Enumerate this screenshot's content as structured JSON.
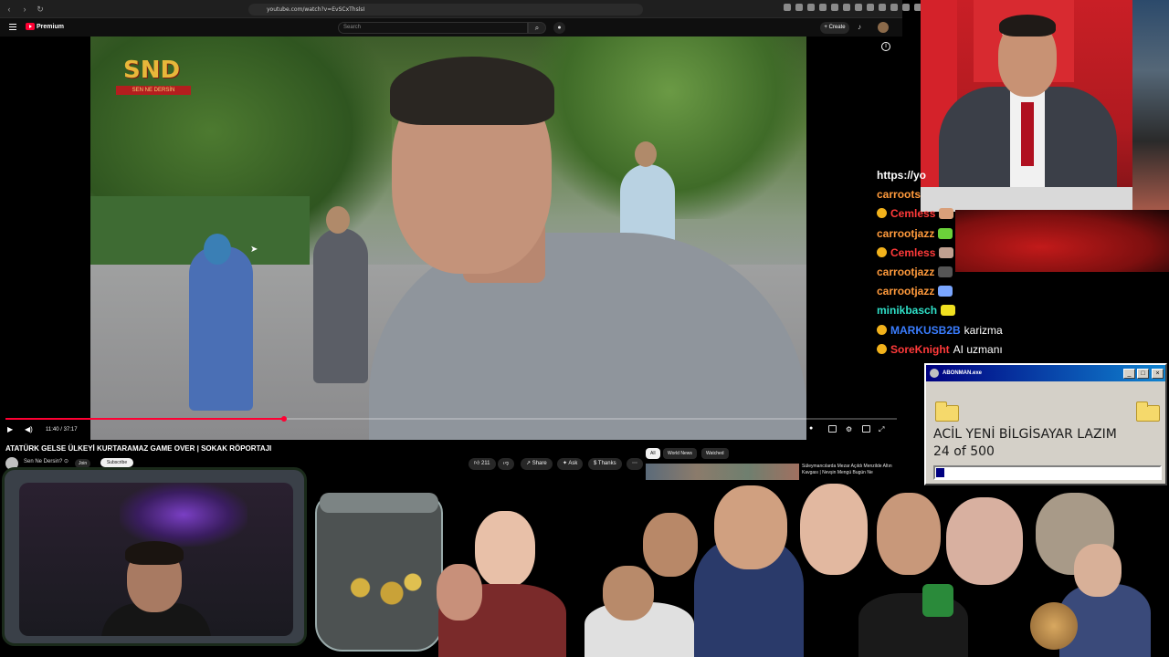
{
  "browser": {
    "url": "youtube.com/watch?v=EvSCxThslsI"
  },
  "youtube": {
    "brand": "Premium",
    "search_placeholder": "Search",
    "create_label": "+ Create",
    "video": {
      "logo_main": "SND",
      "logo_sub": "SEN NE DERSİN",
      "time": "11:40 / 37:17",
      "progress_fraction": 0.313
    },
    "title": "ATATÜRK GELSE ÜLKEYİ KURTARAMAZ GAME OVER | SOKAK RÖPORTAJI",
    "channel": "Sen Ne Dersin? ⊙",
    "join_label": "Join",
    "subscribe_label": "Subscribe",
    "actions": {
      "like_count": "211",
      "share": "Share",
      "ask": "Ask",
      "thanks": "Thanks"
    },
    "chips": [
      "All",
      "World News",
      "Watched"
    ],
    "side_video_title": "Süleymancılarda Mezar Açıldı Menzilde Altın Kavgası | Nevşin Mengü Bugün Ne"
  },
  "chat": {
    "lines": [
      {
        "user": "https://yo",
        "color": "#ffffff",
        "msg": "",
        "badge": false,
        "emote": ""
      },
      {
        "user": "carroots",
        "color": "#ff9a3c",
        "msg": "",
        "badge": false,
        "emote": ""
      },
      {
        "user": "Cemless",
        "color": "#ff3a3a",
        "msg": "",
        "badge": true,
        "emote": "#d9a07a"
      },
      {
        "user": "carrootjazz",
        "color": "#ff9a3c",
        "msg": "",
        "badge": false,
        "emote": "#6bd13a"
      },
      {
        "user": "Cemless",
        "color": "#ff3a3a",
        "msg": "",
        "badge": true,
        "emote": "#c0a090"
      },
      {
        "user": "carrootjazz",
        "color": "#ff9a3c",
        "msg": "",
        "badge": false,
        "emote": "#555555"
      },
      {
        "user": "carrootjazz",
        "color": "#ff9a3c",
        "msg": "",
        "badge": false,
        "emote": "#7aa6ff"
      },
      {
        "user": "minikbasch",
        "color": "#2fe0c8",
        "msg": "",
        "badge": false,
        "emote": "#f0e020"
      },
      {
        "user": "MARKUSB2B",
        "color": "#3a7dff",
        "msg": "karizma",
        "badge": true,
        "emote": ""
      },
      {
        "user": "SoreKnight",
        "color": "#ff3a3a",
        "msg": "AI uzmanı",
        "badge": true,
        "emote": ""
      }
    ]
  },
  "retro_window": {
    "title": "ABONMAN.exe",
    "heading": "ACİL YENİ BİLGİSAYAR LAZIM",
    "count": "24 of 500",
    "progress_fraction": 0.048
  }
}
